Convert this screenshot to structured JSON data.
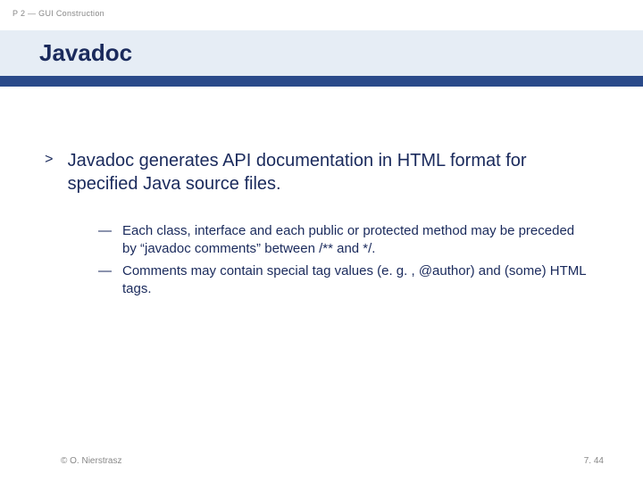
{
  "breadcrumb": "P 2 — GUI Construction",
  "title": "Javadoc",
  "main": {
    "marker": ">",
    "text": "Javadoc generates API documentation in HTML format for specified Java source files."
  },
  "subs": [
    {
      "marker": "—",
      "text": "Each class, interface and each public or protected method may be preceded by “javadoc comments” between /** and */."
    },
    {
      "marker": "—",
      "text": "Comments may contain special tag values (e. g. , @author) and (some) HTML tags."
    }
  ],
  "footer": {
    "copyright": "© O. Nierstrasz",
    "page": "7. 44"
  }
}
